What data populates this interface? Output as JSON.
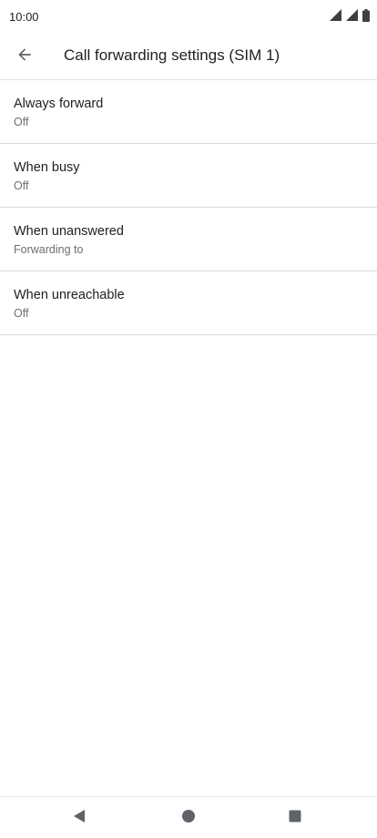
{
  "status_bar": {
    "time": "10:00",
    "icons": [
      "signal-icon",
      "signal-icon",
      "battery-icon"
    ]
  },
  "app_bar": {
    "back_icon": "arrow-back-icon",
    "title": "Call forwarding settings (SIM 1)"
  },
  "settings": [
    {
      "title": "Always forward",
      "summary": "Off"
    },
    {
      "title": "When busy",
      "summary": "Off"
    },
    {
      "title": "When unanswered",
      "summary": "Forwarding to"
    },
    {
      "title": "When unreachable",
      "summary": "Off"
    }
  ],
  "nav_bar": {
    "back_icon": "nav-back-icon",
    "home_icon": "nav-home-icon",
    "recents_icon": "nav-recents-icon"
  },
  "colors": {
    "text_primary": "#202124",
    "text_secondary": "#6e6e6e",
    "divider": "#dcdcdc",
    "icon": "#5f6368"
  }
}
